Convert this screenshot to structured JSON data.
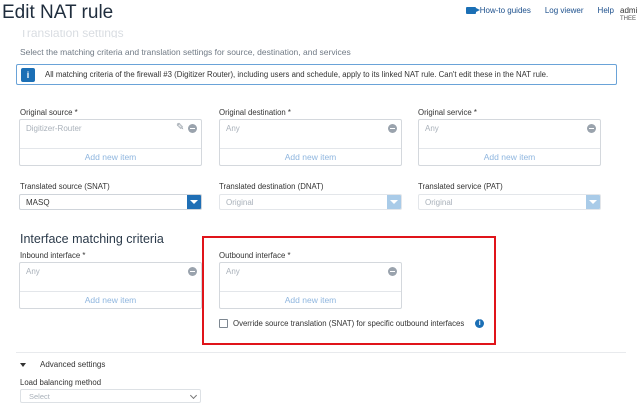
{
  "header": {
    "title": "Edit NAT rule",
    "links": {
      "howto": "How-to guides",
      "log_viewer": "Log viewer",
      "help": "Help"
    },
    "user": "admi",
    "tenant": "THEE"
  },
  "section": {
    "faded_title": "Translation settings",
    "description": "Select the matching criteria and translation settings for source, destination, and services"
  },
  "banner": {
    "icon": "i",
    "text": "All matching criteria of the firewall #3 (Digitizer Router), including users and schedule, apply to its linked NAT rule. Can't edit these in the NAT rule."
  },
  "original": {
    "source": {
      "label": "Original source *",
      "value": "Digitizer-Router",
      "add": "Add new item"
    },
    "destination": {
      "label": "Original destination *",
      "value": "Any",
      "add": "Add new item"
    },
    "service": {
      "label": "Original service *",
      "value": "Any",
      "add": "Add new item"
    }
  },
  "translated": {
    "source": {
      "label": "Translated source (SNAT)",
      "value": "MASQ"
    },
    "destination": {
      "label": "Translated destination (DNAT)",
      "value": "Original"
    },
    "service": {
      "label": "Translated service (PAT)",
      "value": "Original"
    }
  },
  "interface": {
    "heading": "Interface matching criteria",
    "inbound": {
      "label": "Inbound interface *",
      "value": "Any",
      "add": "Add new item"
    },
    "outbound": {
      "label": "Outbound interface *",
      "value": "Any",
      "add": "Add new item"
    },
    "override_label": "Override source translation (SNAT) for specific outbound interfaces",
    "override_checked": false
  },
  "advanced": {
    "label": "Advanced settings",
    "lb_label": "Load balancing method",
    "lb_value": "Select"
  },
  "colors": {
    "accent": "#1f6fb5",
    "highlight": "#e0141a",
    "link": "#8fb6df"
  }
}
